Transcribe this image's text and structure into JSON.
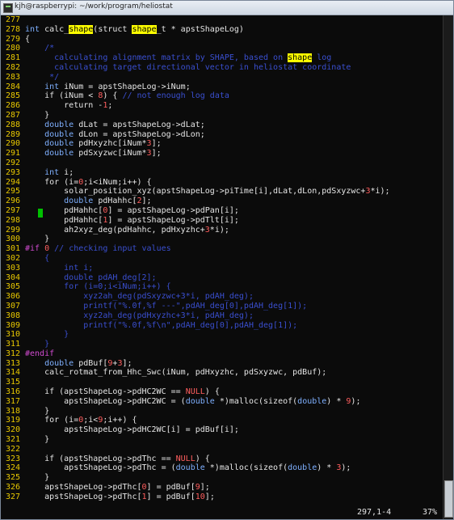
{
  "window": {
    "title": "kjh@raspberrypi: ~/work/program/heliostat"
  },
  "status": {
    "position": "297,1-4",
    "percent": "37%"
  },
  "colors": {
    "line_number": "#e8c800",
    "keyword": "#7fb0ff",
    "comment": "#3a4fd0",
    "number": "#ff5e5e",
    "preproc": "#d14bd1",
    "search_highlight": "#ffff00",
    "cursor": "#00c000"
  },
  "lines": [
    {
      "n": "277",
      "s": []
    },
    {
      "n": "278",
      "s": [
        [
          "k",
          "int"
        ],
        [
          "t",
          " calc_"
        ],
        [
          "h",
          "shape"
        ],
        [
          "t",
          "(struct "
        ],
        [
          "h",
          "shape"
        ],
        [
          "t",
          "_t * apstShapeLog)"
        ]
      ]
    },
    {
      "n": "279",
      "s": [
        [
          "t",
          "{"
        ]
      ]
    },
    {
      "n": "280",
      "s": [
        [
          "c",
          "    /*"
        ]
      ]
    },
    {
      "n": "281",
      "s": [
        [
          "c",
          "      calculating alignment matrix by SHAPE, based on "
        ],
        [
          "h",
          "shape"
        ],
        [
          "c",
          " log"
        ]
      ]
    },
    {
      "n": "282",
      "s": [
        [
          "c",
          "      calculating target directional vector in heliostat coordinate"
        ]
      ]
    },
    {
      "n": "283",
      "s": [
        [
          "c",
          "     */"
        ]
      ]
    },
    {
      "n": "284",
      "s": [
        [
          "k",
          "    int"
        ],
        [
          "t",
          " iNum = apstShapeLog->iNum;"
        ]
      ]
    },
    {
      "n": "285",
      "s": [
        [
          "t",
          "    if (iNum < "
        ],
        [
          "n",
          "8"
        ],
        [
          "t",
          ") { "
        ],
        [
          "c",
          "// not enough log data"
        ]
      ]
    },
    {
      "n": "286",
      "s": [
        [
          "t",
          "        return -"
        ],
        [
          "n",
          "1"
        ],
        [
          "t",
          ";"
        ]
      ]
    },
    {
      "n": "287",
      "s": [
        [
          "t",
          "    }"
        ]
      ]
    },
    {
      "n": "288",
      "s": [
        [
          "k",
          "    double"
        ],
        [
          "t",
          " dLat = apstShapeLog->dLat;"
        ]
      ]
    },
    {
      "n": "289",
      "s": [
        [
          "k",
          "    double"
        ],
        [
          "t",
          " dLon = apstShapeLog->dLon;"
        ]
      ]
    },
    {
      "n": "290",
      "s": [
        [
          "k",
          "    double"
        ],
        [
          "t",
          " pdHxyzhc[iNum*"
        ],
        [
          "n",
          "3"
        ],
        [
          "t",
          "];"
        ]
      ]
    },
    {
      "n": "291",
      "s": [
        [
          "k",
          "    double"
        ],
        [
          "t",
          " pdSxyzwc[iNum*"
        ],
        [
          "n",
          "3"
        ],
        [
          "t",
          "];"
        ]
      ]
    },
    {
      "n": "292",
      "s": []
    },
    {
      "n": "293",
      "s": [
        [
          "k",
          "    int"
        ],
        [
          "t",
          " i;"
        ]
      ]
    },
    {
      "n": "294",
      "s": [
        [
          "t",
          "    for (i="
        ],
        [
          "n",
          "0"
        ],
        [
          "t",
          ";i<iNum;i++) {"
        ]
      ]
    },
    {
      "n": "295",
      "s": [
        [
          "t",
          "        solar_position_xyz(apstShapeLog->piTime[i],dLat,dLon,pdSxyzwc+"
        ],
        [
          "n",
          "3"
        ],
        [
          "t",
          "*i);"
        ]
      ]
    },
    {
      "n": "296",
      "s": [
        [
          "k",
          "        double"
        ],
        [
          "t",
          " pdHahhc["
        ],
        [
          "n",
          "2"
        ],
        [
          "t",
          "];"
        ]
      ]
    },
    {
      "n": "297",
      "s": [
        [
          "t",
          "        pdHahhc["
        ],
        [
          "n",
          "0"
        ],
        [
          "t",
          "] = apstShapeLog->pdPan[i];"
        ]
      ]
    },
    {
      "n": "298",
      "s": [
        [
          "t",
          "        pdHahhc["
        ],
        [
          "n",
          "1"
        ],
        [
          "t",
          "] = apstShapeLog->pdTlt[i];"
        ]
      ]
    },
    {
      "n": "299",
      "s": [
        [
          "t",
          "        ah2xyz_deg(pdHahhc, pdHxyzhc+"
        ],
        [
          "n",
          "3"
        ],
        [
          "t",
          "*i);"
        ]
      ]
    },
    {
      "n": "300",
      "s": [
        [
          "t",
          "    }"
        ]
      ]
    },
    {
      "n": "301",
      "s": [
        [
          "p",
          "#if"
        ],
        [
          "t",
          " "
        ],
        [
          "n",
          "0"
        ],
        [
          "c",
          " // checking input values"
        ]
      ]
    },
    {
      "n": "302",
      "s": [
        [
          "c",
          "    {"
        ]
      ]
    },
    {
      "n": "303",
      "s": [
        [
          "c",
          "        int i;"
        ]
      ]
    },
    {
      "n": "304",
      "s": [
        [
          "c",
          "        double pdAH_deg[2];"
        ]
      ]
    },
    {
      "n": "305",
      "s": [
        [
          "c",
          "        for (i=0;i<iNum;i++) {"
        ]
      ]
    },
    {
      "n": "306",
      "s": [
        [
          "c",
          "            xyz2ah_deg(pdSxyzwc+3*i, pdAH_deg);"
        ]
      ]
    },
    {
      "n": "307",
      "s": [
        [
          "c",
          "            printf(\"%.0f,%f ---\",pdAH_deg[0],pdAH_deg[1]);"
        ]
      ]
    },
    {
      "n": "308",
      "s": [
        [
          "c",
          "            xyz2ah_deg(pdHxyzhc+3*i, pdAH_deg);"
        ]
      ]
    },
    {
      "n": "309",
      "s": [
        [
          "c",
          "            printf(\"%.0f,%f\\n\",pdAH_deg[0],pdAH_deg[1]);"
        ]
      ]
    },
    {
      "n": "310",
      "s": [
        [
          "c",
          "        }"
        ]
      ]
    },
    {
      "n": "311",
      "s": [
        [
          "c",
          "    }"
        ]
      ]
    },
    {
      "n": "312",
      "s": [
        [
          "p",
          "#endif"
        ]
      ]
    },
    {
      "n": "313",
      "s": [
        [
          "k",
          "    double"
        ],
        [
          "t",
          " pdBuf["
        ],
        [
          "n",
          "9"
        ],
        [
          "t",
          "+"
        ],
        [
          "n",
          "3"
        ],
        [
          "t",
          "];"
        ]
      ]
    },
    {
      "n": "314",
      "s": [
        [
          "t",
          "    calc_rotmat_from_Hhc_Swc(iNum, pdHxyzhc, pdSxyzwc, pdBuf);"
        ]
      ]
    },
    {
      "n": "315",
      "s": []
    },
    {
      "n": "316",
      "s": [
        [
          "t",
          "    if (apstShapeLog->pdHC2WC == "
        ],
        [
          "n",
          "NULL"
        ],
        [
          "t",
          ") {"
        ]
      ]
    },
    {
      "n": "317",
      "s": [
        [
          "t",
          "        apstShapeLog->pdHC2WC = ("
        ],
        [
          "k",
          "double"
        ],
        [
          "t",
          " *)malloc(sizeof("
        ],
        [
          "k",
          "double"
        ],
        [
          "t",
          ") * "
        ],
        [
          "n",
          "9"
        ],
        [
          "t",
          ");"
        ]
      ]
    },
    {
      "n": "318",
      "s": [
        [
          "t",
          "    }"
        ]
      ]
    },
    {
      "n": "319",
      "s": [
        [
          "t",
          "    for (i="
        ],
        [
          "n",
          "0"
        ],
        [
          "t",
          ";i<"
        ],
        [
          "n",
          "9"
        ],
        [
          "t",
          ";i++) {"
        ]
      ]
    },
    {
      "n": "320",
      "s": [
        [
          "t",
          "        apstShapeLog->pdHC2WC[i] = pdBuf[i];"
        ]
      ]
    },
    {
      "n": "321",
      "s": [
        [
          "t",
          "    }"
        ]
      ]
    },
    {
      "n": "322",
      "s": []
    },
    {
      "n": "323",
      "s": [
        [
          "t",
          "    if (apstShapeLog->pdThc == "
        ],
        [
          "n",
          "NULL"
        ],
        [
          "t",
          ") {"
        ]
      ]
    },
    {
      "n": "324",
      "s": [
        [
          "t",
          "        apstShapeLog->pdThc = ("
        ],
        [
          "k",
          "double"
        ],
        [
          "t",
          " *)malloc(sizeof("
        ],
        [
          "k",
          "double"
        ],
        [
          "t",
          ") * "
        ],
        [
          "n",
          "3"
        ],
        [
          "t",
          ");"
        ]
      ]
    },
    {
      "n": "325",
      "s": [
        [
          "t",
          "    }"
        ]
      ]
    },
    {
      "n": "326",
      "s": [
        [
          "t",
          "    apstShapeLog->pdThc["
        ],
        [
          "n",
          "0"
        ],
        [
          "t",
          "] = pdBuf["
        ],
        [
          "n",
          "9"
        ],
        [
          "t",
          "];"
        ]
      ]
    },
    {
      "n": "327",
      "s": [
        [
          "t",
          "    apstShapeLog->pdThc["
        ],
        [
          "n",
          "1"
        ],
        [
          "t",
          "] = pdBuf["
        ],
        [
          "n",
          "10"
        ],
        [
          "t",
          "];"
        ]
      ]
    }
  ]
}
